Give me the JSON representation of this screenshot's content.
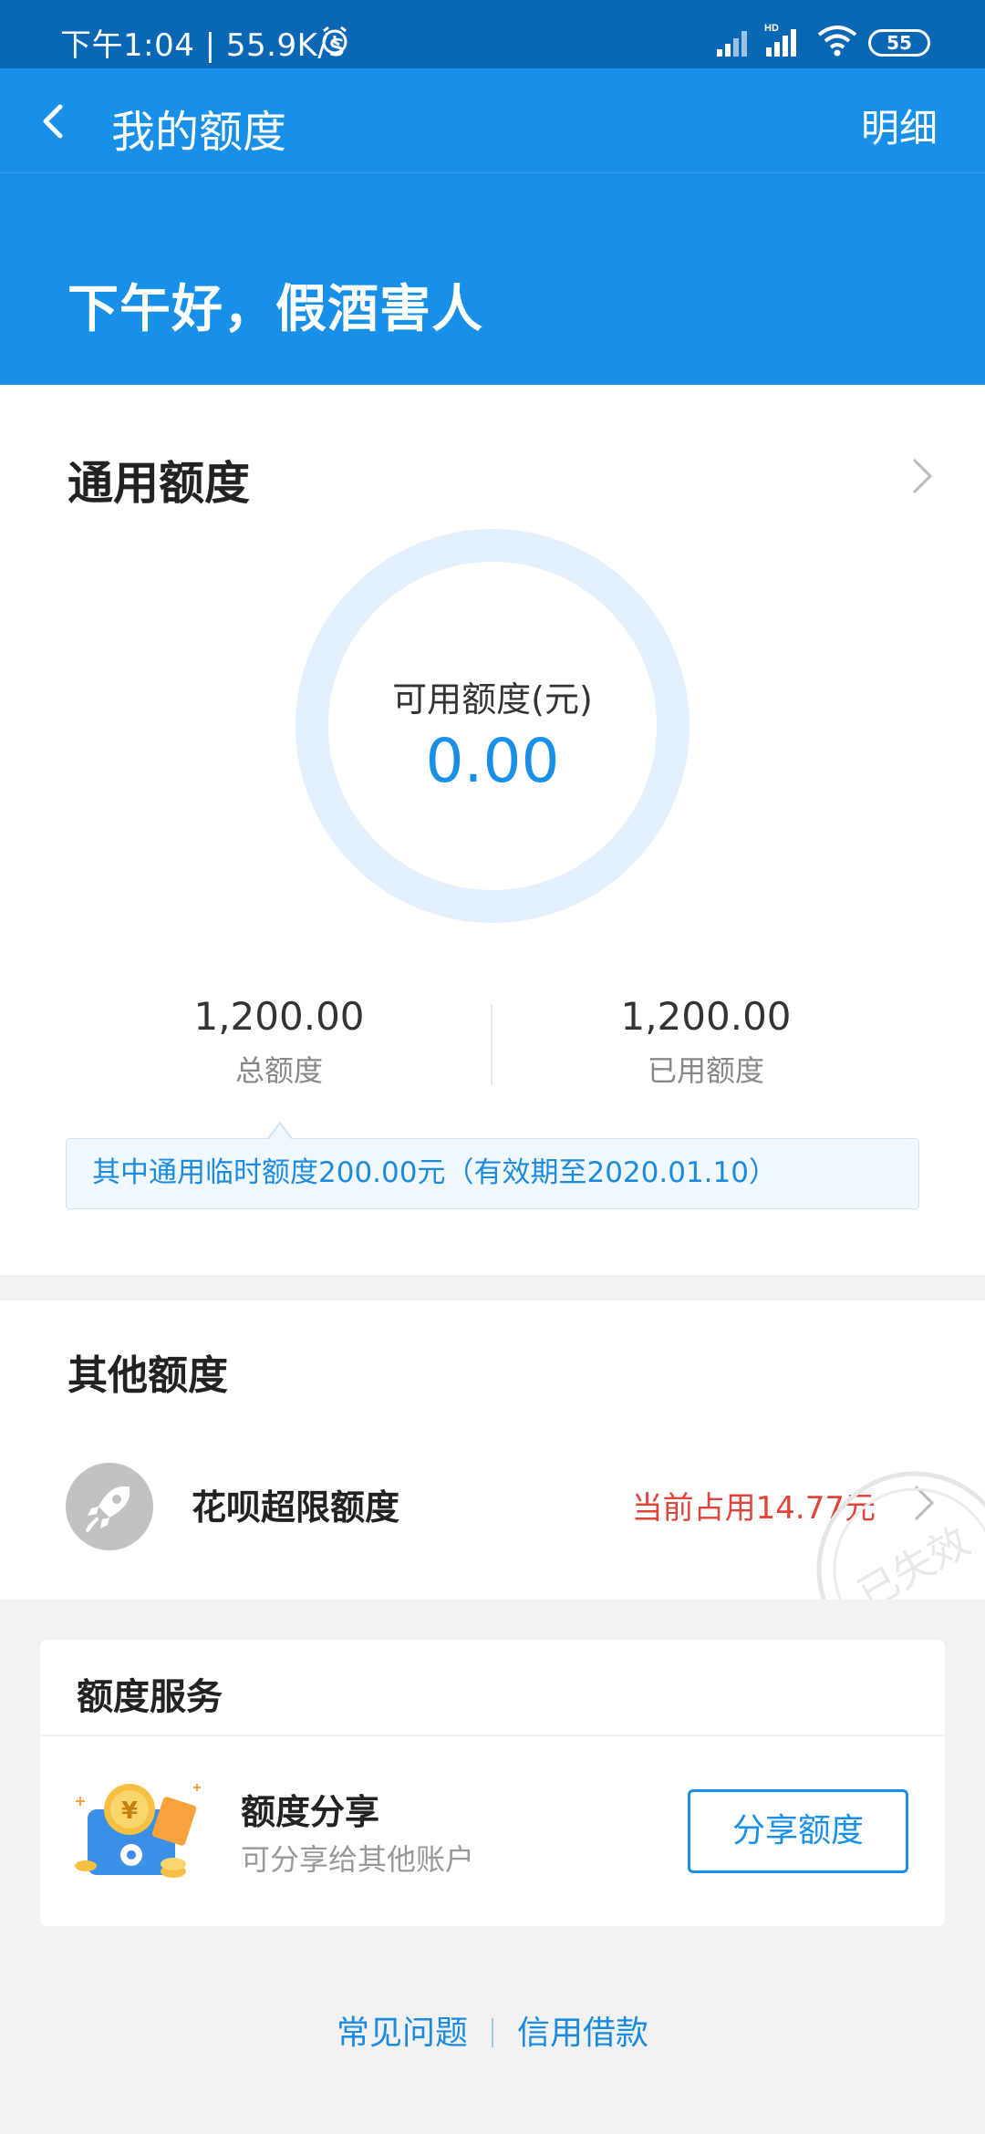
{
  "status_bar": {
    "time": "下午1:04 | 55.9K/s",
    "battery": "55"
  },
  "nav": {
    "title": "我的额度",
    "detail": "明细"
  },
  "greeting": "下午好，假酒害人",
  "general_quota": {
    "title": "通用额度",
    "available_label": "可用额度(元)",
    "available_value": "0.00",
    "total_value": "1,200.00",
    "total_label": "总额度",
    "used_value": "1,200.00",
    "used_label": "已用额度",
    "note": "其中通用临时额度200.00元（有效期至2020.01.10）"
  },
  "other_quota": {
    "title": "其他额度",
    "item_name": "花呗超限额度",
    "item_usage": "当前占用14.77元",
    "stamp": "已失效"
  },
  "service": {
    "title": "额度服务",
    "item_name": "额度分享",
    "item_desc": "可分享给其他账户",
    "button": "分享额度"
  },
  "footer": {
    "faq": "常见问题",
    "credit_loan": "信用借款"
  },
  "colors": {
    "brand_blue": "#1890e8",
    "status_blue": "#0a67b5",
    "warning_red": "#e0443a"
  }
}
